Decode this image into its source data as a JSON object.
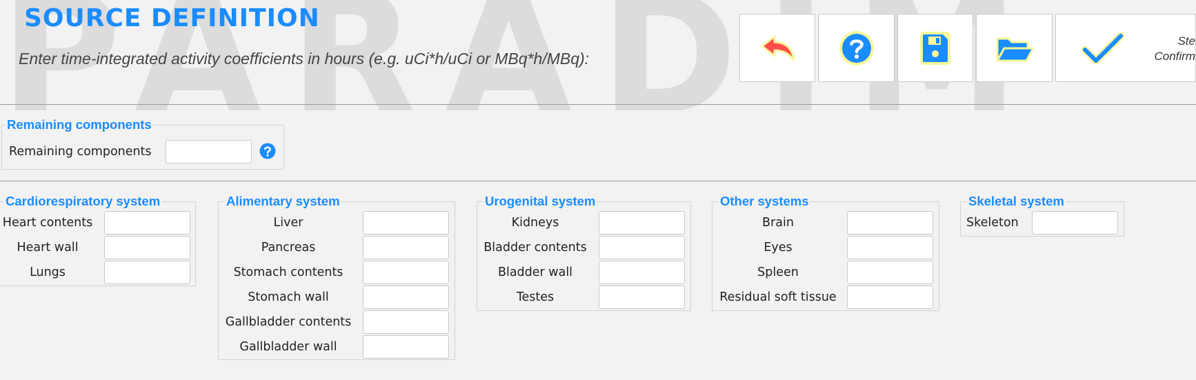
{
  "watermark": "PARADIM",
  "header": {
    "title": "SOURCE DEFINITION",
    "subtitle": "Enter time-integrated activity coefficients in hours (e.g. uCi*h/uCi or MBq*h/MBq):"
  },
  "toolbar": {
    "confirm_label_line1": "Ste",
    "confirm_label_line2": "Confirm",
    "icons": [
      "undo-arrow-icon",
      "help-icon",
      "save-icon",
      "folder-open-icon",
      "check-icon"
    ]
  },
  "remaining": {
    "legend": "Remaining components",
    "label": "Remaining components",
    "value": ""
  },
  "groups": {
    "cardio": {
      "legend": "Cardiorespiratory system",
      "fields": [
        {
          "label": "Heart contents",
          "value": ""
        },
        {
          "label": "Heart wall",
          "value": ""
        },
        {
          "label": "Lungs",
          "value": ""
        }
      ]
    },
    "alimentary": {
      "legend": "Alimentary system",
      "fields": [
        {
          "label": "Liver",
          "value": ""
        },
        {
          "label": "Pancreas",
          "value": ""
        },
        {
          "label": "Stomach contents",
          "value": ""
        },
        {
          "label": "Stomach wall",
          "value": ""
        },
        {
          "label": "Gallbladder contents",
          "value": ""
        },
        {
          "label": "Gallbladder wall",
          "value": ""
        }
      ]
    },
    "urogenital": {
      "legend": "Urogenital system",
      "fields": [
        {
          "label": "Kidneys",
          "value": ""
        },
        {
          "label": "Bladder contents",
          "value": ""
        },
        {
          "label": "Bladder wall",
          "value": ""
        },
        {
          "label": "Testes",
          "value": ""
        }
      ]
    },
    "other": {
      "legend": "Other systems",
      "fields": [
        {
          "label": "Brain",
          "value": ""
        },
        {
          "label": "Eyes",
          "value": ""
        },
        {
          "label": "Spleen",
          "value": ""
        },
        {
          "label": "Residual soft tissue",
          "value": ""
        }
      ]
    },
    "skeletal": {
      "legend": "Skeletal system",
      "fields": [
        {
          "label": "Skeleton",
          "value": ""
        }
      ]
    }
  },
  "colors": {
    "accent": "#1a8cff",
    "undo": "#ff4d4d",
    "icon_glow": "#f7f79a"
  }
}
